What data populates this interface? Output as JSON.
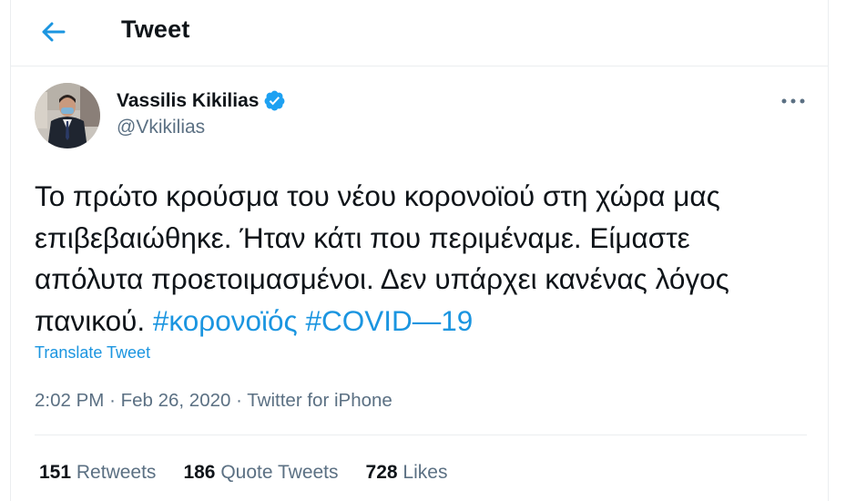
{
  "header": {
    "title": "Tweet",
    "back_icon": "arrow-left-icon"
  },
  "author": {
    "name": "Vassilis Kikilias",
    "handle": "@Vkikilias",
    "verified_icon": "verified-badge-icon"
  },
  "tweet": {
    "text_plain": "Το πρώτο κρούσμα του νέου κορονοϊού στη χώρα μας επιβεβαιώθηκε. Ήταν κάτι που περιμέναμε. Είμαστε απόλυτα προετοιμασμένοι. Δεν υπάρχει κανένας λόγος πανικού. ",
    "hashtags": [
      "#κορονοϊός",
      "#COVID—19"
    ],
    "translate_label": "Translate Tweet"
  },
  "meta": {
    "time": "2:02 PM",
    "date": "Feb 26, 2020",
    "source": "Twitter for iPhone",
    "separator": "·"
  },
  "stats": {
    "retweets_count": "151",
    "retweets_label": "Retweets",
    "quotes_count": "186",
    "quotes_label": "Quote Tweets",
    "likes_count": "728",
    "likes_label": "Likes"
  },
  "colors": {
    "accent": "#1b95e0",
    "verified": "#1da1f2",
    "secondary_text": "#5b7083",
    "primary_text": "#0f1419",
    "border": "#ebeef0"
  }
}
